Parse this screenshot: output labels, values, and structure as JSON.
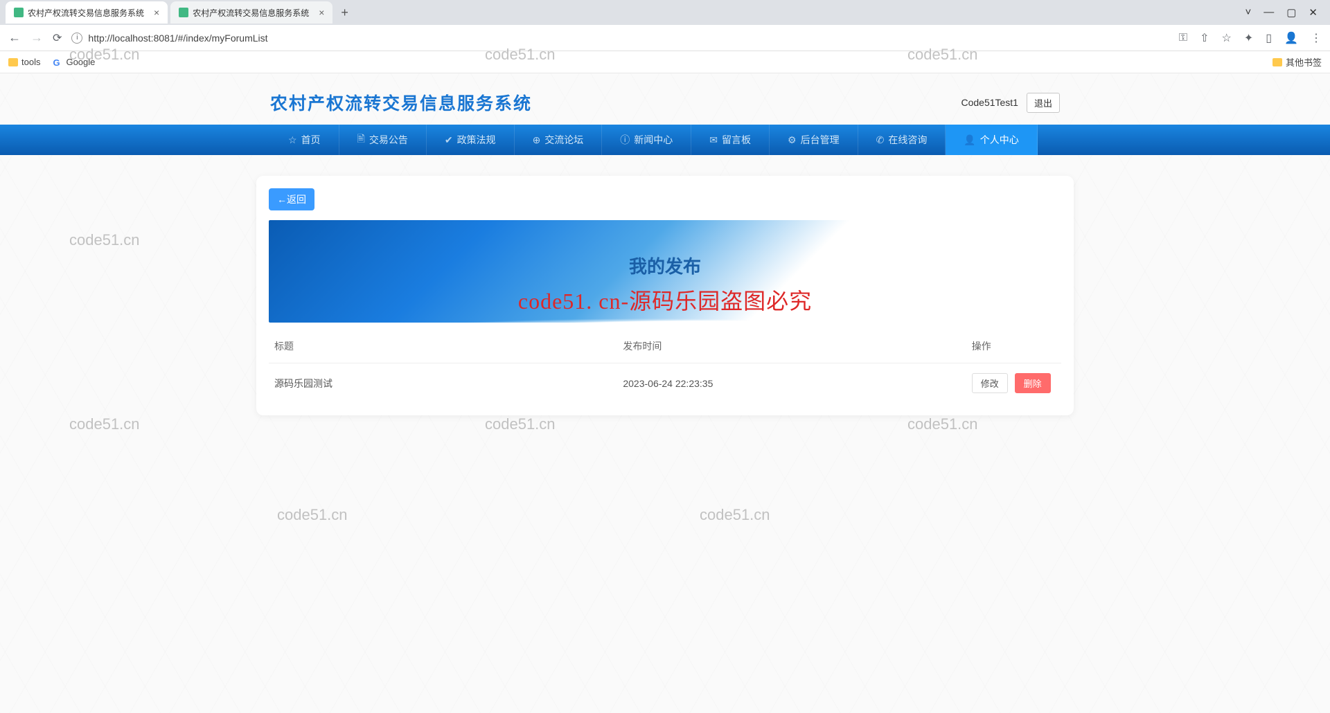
{
  "browser": {
    "tabs": [
      {
        "title": "农村产权流转交易信息服务系统"
      },
      {
        "title": "农村产权流转交易信息服务系统"
      }
    ],
    "url": "http://localhost:8081/#/index/myForumList",
    "bookmarks": {
      "tools": "tools",
      "google": "Google",
      "other": "其他书签"
    }
  },
  "header": {
    "site_title": "农村产权流转交易信息服务系统",
    "username": "Code51Test1",
    "logout": "退出"
  },
  "nav": {
    "items": [
      {
        "icon": "☆",
        "label": "首页"
      },
      {
        "icon": "🖹",
        "label": "交易公告"
      },
      {
        "icon": "✔",
        "label": "政策法规"
      },
      {
        "icon": "⊕",
        "label": "交流论坛"
      },
      {
        "icon": "ⓘ",
        "label": "新闻中心"
      },
      {
        "icon": "✉",
        "label": "留言板"
      },
      {
        "icon": "⚙",
        "label": "后台管理"
      },
      {
        "icon": "✆",
        "label": "在线咨询"
      },
      {
        "icon": "👤",
        "label": "个人中心",
        "active": true
      }
    ]
  },
  "content": {
    "back_label": "←返回",
    "banner_title": "我的发布",
    "red_text": "code51. cn-源码乐园盗图必究",
    "table": {
      "headers": {
        "title": "标题",
        "time": "发布时间",
        "action": "操作"
      },
      "rows": [
        {
          "title": "源码乐园测试",
          "time": "2023-06-24 22:23:35"
        }
      ],
      "actions": {
        "edit": "修改",
        "delete": "删除"
      }
    }
  },
  "watermarks": [
    "code51.cn"
  ]
}
